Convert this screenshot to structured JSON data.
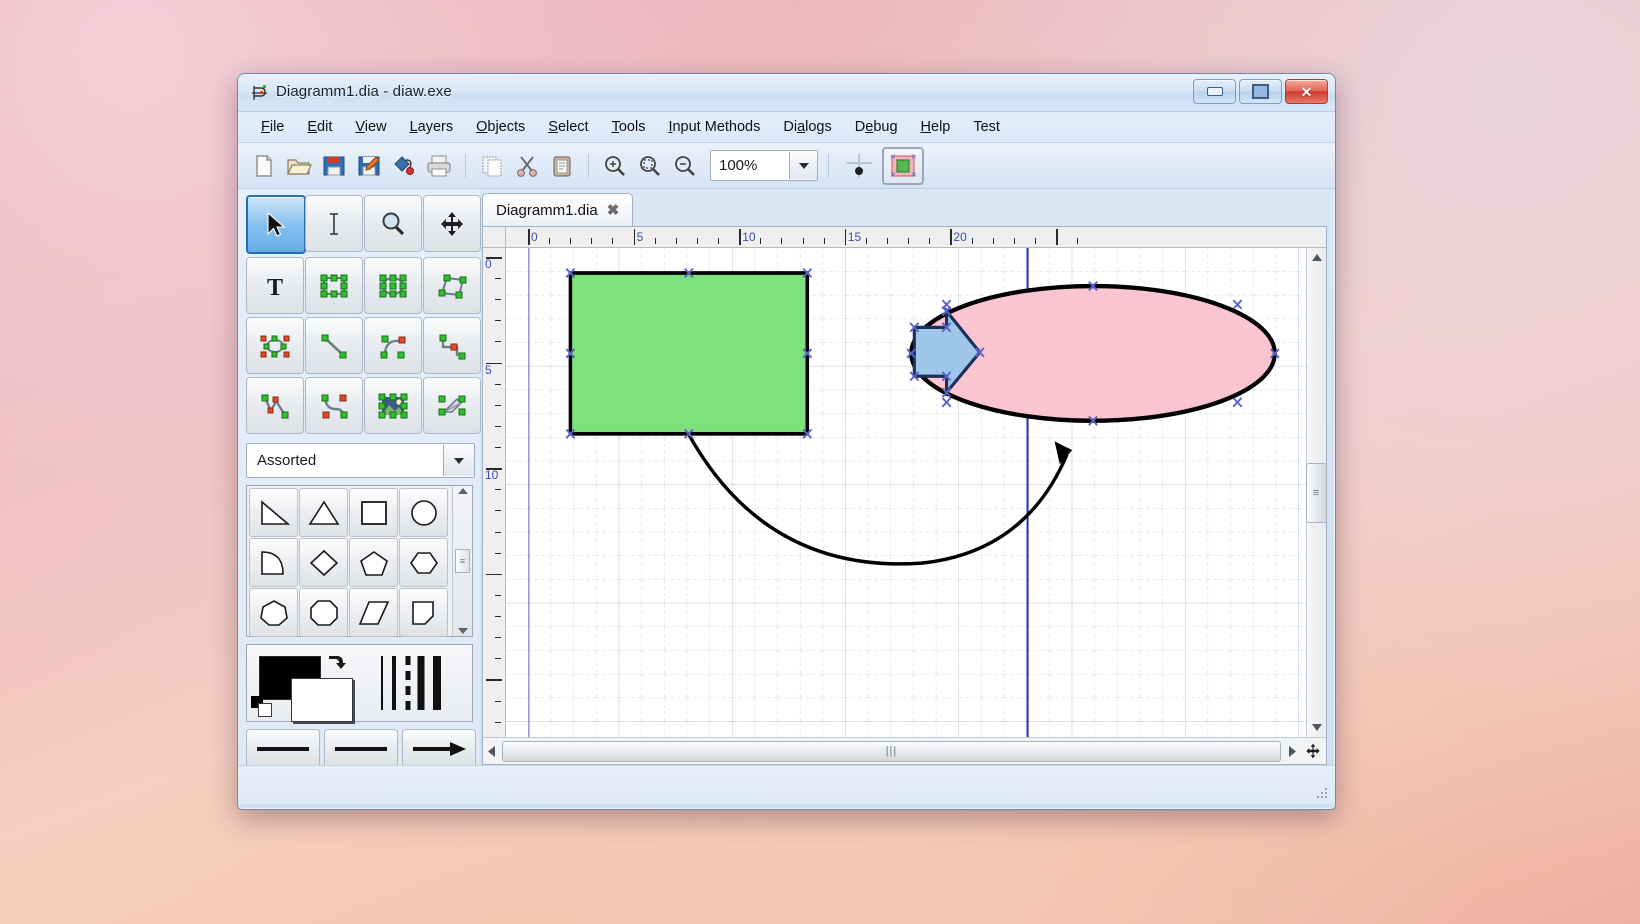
{
  "window": {
    "title": "Diagramm1.dia - diaw.exe",
    "icon": "dia-app-icon",
    "controls": {
      "minimize": "Minimize",
      "maximize": "Maximize",
      "close": "Close"
    }
  },
  "menubar": {
    "items": [
      {
        "label": "File",
        "accel": "F"
      },
      {
        "label": "Edit",
        "accel": "E"
      },
      {
        "label": "View",
        "accel": "V"
      },
      {
        "label": "Layers",
        "accel": "L"
      },
      {
        "label": "Objects",
        "accel": "O"
      },
      {
        "label": "Select",
        "accel": "S"
      },
      {
        "label": "Tools",
        "accel": "T"
      },
      {
        "label": "Input Methods",
        "accel": "I"
      },
      {
        "label": "Dialogs",
        "accel": "a"
      },
      {
        "label": "Debug",
        "accel": "e"
      },
      {
        "label": "Help",
        "accel": "H"
      },
      {
        "label": "Test",
        "accel": ""
      }
    ]
  },
  "toolbar": {
    "buttons": [
      {
        "name": "new-icon",
        "title": "New"
      },
      {
        "name": "open-icon",
        "title": "Open"
      },
      {
        "name": "save-icon",
        "title": "Save"
      },
      {
        "name": "save-as-icon",
        "title": "Save As"
      },
      {
        "name": "export-icon",
        "title": "Export"
      },
      {
        "name": "print-icon",
        "title": "Print"
      },
      {
        "name": "copy-icon",
        "title": "Copy"
      },
      {
        "name": "cut-icon",
        "title": "Cut"
      },
      {
        "name": "paste-icon",
        "title": "Paste"
      },
      {
        "name": "zoom-in-icon",
        "title": "Zoom In"
      },
      {
        "name": "zoom-fit-icon",
        "title": "Zoom Fit"
      },
      {
        "name": "zoom-out-icon",
        "title": "Zoom Out"
      }
    ],
    "zoom_value": "100%",
    "snap_to_grid": "snap-to-grid-icon",
    "snap_to_objects": "snap-to-objects-icon"
  },
  "toolbox": {
    "tools": [
      {
        "name": "modify-tool",
        "label": "Modify",
        "selected": true
      },
      {
        "name": "text-edit-tool",
        "label": "Text Edit",
        "selected": false
      },
      {
        "name": "magnify-tool",
        "label": "Magnify",
        "selected": false
      },
      {
        "name": "scroll-tool",
        "label": "Scroll",
        "selected": false
      },
      {
        "name": "text-tool",
        "label": "Text",
        "selected": false
      },
      {
        "name": "box-tool",
        "label": "Box",
        "selected": false
      },
      {
        "name": "ellipse-tool",
        "label": "Ellipse",
        "selected": false
      },
      {
        "name": "polygon-tool",
        "label": "Polygon",
        "selected": false
      },
      {
        "name": "beziergon-tool",
        "label": "Beziergon",
        "selected": false
      },
      {
        "name": "line-tool",
        "label": "Line",
        "selected": false
      },
      {
        "name": "arc-tool",
        "label": "Arc",
        "selected": false
      },
      {
        "name": "zigzagline-tool",
        "label": "Zigzagline",
        "selected": false
      },
      {
        "name": "polyline-tool",
        "label": "Polyline",
        "selected": false
      },
      {
        "name": "bezierline-tool",
        "label": "Bezierline",
        "selected": false
      },
      {
        "name": "image-tool",
        "label": "Image",
        "selected": false
      },
      {
        "name": "outline-tool",
        "label": "Outline",
        "selected": false
      }
    ],
    "sheet": {
      "selected": "Assorted"
    },
    "shapes": [
      {
        "name": "right-triangle-shape"
      },
      {
        "name": "triangle-shape"
      },
      {
        "name": "square-shape"
      },
      {
        "name": "circle-shape"
      },
      {
        "name": "quarter-circle-shape"
      },
      {
        "name": "diamond-shape"
      },
      {
        "name": "pentagon-shape"
      },
      {
        "name": "hexagon-shape"
      },
      {
        "name": "heptagon-shape"
      },
      {
        "name": "octagon-shape"
      },
      {
        "name": "parallelogram-shape"
      },
      {
        "name": "trapezoid-shape"
      }
    ],
    "colors": {
      "foreground": "#000000",
      "background": "#ffffff",
      "swap": "swap-colors-icon",
      "reset": "reset-colors-icon"
    },
    "line_styles": [
      {
        "name": "line-style-solid"
      },
      {
        "name": "line-style-dashed"
      },
      {
        "name": "line-style-thick"
      }
    ],
    "arrow_buttons": [
      {
        "name": "arrow-start-none"
      },
      {
        "name": "arrow-mid-none"
      },
      {
        "name": "arrow-end-filled"
      }
    ]
  },
  "document": {
    "tab": {
      "label": "Diagramm1.dia",
      "close": "✖"
    },
    "ruler": {
      "horizontal_labels": [
        "0",
        "5",
        "10",
        "15",
        "20"
      ],
      "vertical_labels": [
        "0",
        "5",
        "10"
      ],
      "unit": "cm"
    },
    "objects": [
      {
        "name": "green-rectangle",
        "type": "box",
        "fill": "#7de27d",
        "stroke": "#000000",
        "selected": true
      },
      {
        "name": "blue-block-arrow",
        "type": "arrow",
        "fill": "#9dc6e8",
        "stroke": "#1c2f5c",
        "selected": true
      },
      {
        "name": "pink-ellipse",
        "type": "ellipse",
        "fill": "#fbc4d1",
        "stroke": "#000000",
        "selected": true
      },
      {
        "name": "curved-arc-connector",
        "type": "arc",
        "stroke": "#000000",
        "selected": false
      }
    ],
    "guide": {
      "name": "vertical-guide",
      "color": "#2b35a8",
      "position": "15"
    }
  },
  "scrollbars": {
    "horizontal_grip": "|||",
    "vertical_grip": "≡",
    "pan_button": "pan-icon"
  },
  "statusbar": {
    "text": ""
  }
}
